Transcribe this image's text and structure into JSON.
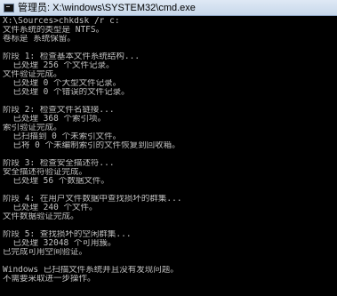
{
  "window": {
    "title": "管理员: X:\\windows\\SYSTEM32\\cmd.exe",
    "icon": "cmd-icon"
  },
  "console": {
    "lines": [
      "X:\\Sources>chkdsk /r c:",
      "文件系统的类型是 NTFS。",
      "卷标是 系统保留。",
      "",
      "阶段 1: 检查基本文件系统结构...",
      "  已处理 256 个文件记录。",
      "文件验证完成。",
      "  已处理 0 个大型文件记录。",
      "  已处理 0 个错误的文件记录。",
      "",
      "阶段 2: 检查文件名链接...",
      "  已处理 368 个索引项。",
      "索引验证完成。",
      "  已扫描到 0 个未索引文件。",
      "  已将 0 个未编制索引的文件恢复到回收箱。",
      "",
      "阶段 3: 检查安全描述符...",
      "安全描述符验证完成。",
      "  已处理 56 个数据文件。",
      "",
      "阶段 4: 在用户文件数据中查找损坏的群集...",
      "  已处理 240 个文件。",
      "文件数据验证完成。",
      "",
      "阶段 5: 查找损坏的空闲群集...",
      "  已处理 32048 个可用簇。",
      "已完成可用空间验证。",
      "",
      "Windows 已扫描文件系统并且没有发现问题。",
      "不需要采取进一步操作。"
    ]
  },
  "colors": {
    "console_background": "#000000",
    "console_text": "#c0c0c0",
    "titlebar": "#d6e3f2"
  }
}
